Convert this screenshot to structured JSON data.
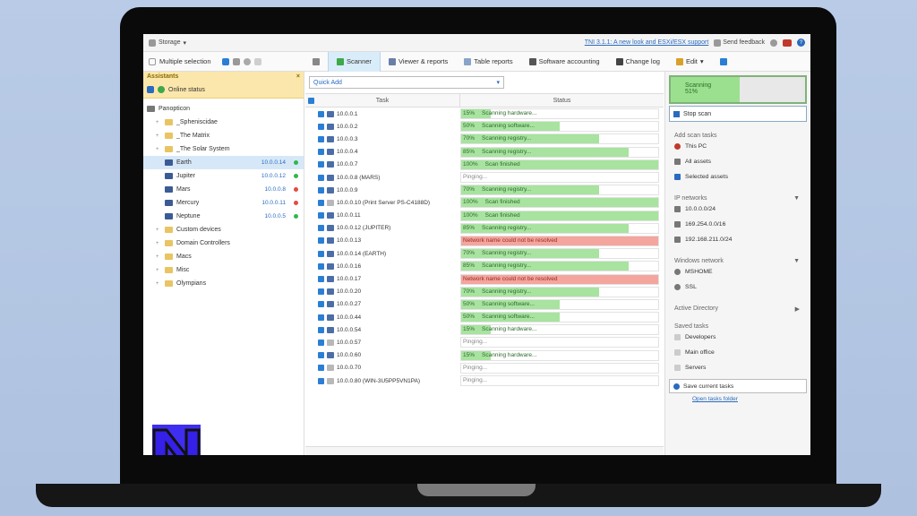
{
  "topbar": {
    "storage_label": "Storage",
    "news_link": "TNI 3.1.1: A new look and ESXi/ESX support",
    "feedback_label": "Send feedback"
  },
  "toolbar": {
    "multiple_selection": "Multiple selection",
    "tabs": [
      "Scanner",
      "Viewer & reports",
      "Table reports",
      "Software accounting",
      "Change log",
      "Edit"
    ]
  },
  "left": {
    "assistants_label": "Assistants",
    "online_status": "Online status",
    "root": "Panopticon",
    "tree": [
      {
        "label": "_Spheniscidae"
      },
      {
        "label": "_The Matrix"
      },
      {
        "label": "_The Solar System"
      },
      {
        "label": "Earth",
        "ip": "10.0.0.14",
        "status": "#2fb84a"
      },
      {
        "label": "Jupiter",
        "ip": "10.0.0.12",
        "status": "#2fb84a"
      },
      {
        "label": "Mars",
        "ip": "10.0.0.8",
        "status": "#e44b3c"
      },
      {
        "label": "Mercury",
        "ip": "10.0.0.11",
        "status": "#e44b3c"
      },
      {
        "label": "Neptune",
        "ip": "10.0.0.5",
        "status": "#2fb84a"
      },
      {
        "label": "Custom devices"
      },
      {
        "label": "Domain Controllers"
      },
      {
        "label": "Macs"
      },
      {
        "label": "Misc"
      },
      {
        "label": "Olympians"
      }
    ]
  },
  "center": {
    "quick_add": "Quick Add",
    "col_task": "Task",
    "col_status": "Status",
    "rows": [
      {
        "task": "10.0.0.1",
        "status": "Scanning hardware...",
        "progress": 15,
        "pct": "15%",
        "kind": "ok",
        "icon": "pc"
      },
      {
        "task": "10.0.0.2",
        "status": "Scanning software...",
        "progress": 50,
        "pct": "50%",
        "kind": "ok",
        "icon": "pc"
      },
      {
        "task": "10.0.0.3",
        "status": "Scanning registry...",
        "progress": 70,
        "pct": "70%",
        "kind": "ok",
        "icon": "pc"
      },
      {
        "task": "10.0.0.4",
        "status": "Scanning registry...",
        "progress": 85,
        "pct": "85%",
        "kind": "ok",
        "icon": "pc"
      },
      {
        "task": "10.0.0.7",
        "status": "Scan finished",
        "progress": 100,
        "pct": "100%",
        "kind": "ok",
        "icon": "pc"
      },
      {
        "task": "10.0.0.8 (MARS)",
        "status": "Pinging...",
        "progress": 0,
        "pct": "",
        "kind": "plain",
        "icon": "pc"
      },
      {
        "task": "10.0.0.9",
        "status": "Scanning registry...",
        "progress": 70,
        "pct": "70%",
        "kind": "ok",
        "icon": "pc"
      },
      {
        "task": "10.0.0.10 (Print Server PS-C4188D)",
        "status": "Scan finished",
        "progress": 100,
        "pct": "100%",
        "kind": "ok",
        "icon": "gray"
      },
      {
        "task": "10.0.0.11",
        "status": "Scan finished",
        "progress": 100,
        "pct": "100%",
        "kind": "ok",
        "icon": "pc"
      },
      {
        "task": "10.0.0.12 (JUPITER)",
        "status": "Scanning registry...",
        "progress": 85,
        "pct": "85%",
        "kind": "ok",
        "icon": "pc"
      },
      {
        "task": "10.0.0.13",
        "status": "Network name could not be resolved",
        "progress": 100,
        "pct": "",
        "kind": "err",
        "icon": "pc"
      },
      {
        "task": "10.0.0.14 (EARTH)",
        "status": "Scanning registry...",
        "progress": 70,
        "pct": "70%",
        "kind": "ok",
        "icon": "pc"
      },
      {
        "task": "10.0.0.16",
        "status": "Scanning registry...",
        "progress": 85,
        "pct": "85%",
        "kind": "ok",
        "icon": "pc"
      },
      {
        "task": "10.0.0.17",
        "status": "Network name could not be resolved",
        "progress": 100,
        "pct": "",
        "kind": "err",
        "icon": "pc"
      },
      {
        "task": "10.0.0.20",
        "status": "Scanning registry...",
        "progress": 70,
        "pct": "70%",
        "kind": "ok",
        "icon": "pc"
      },
      {
        "task": "10.0.0.27",
        "status": "Scanning software...",
        "progress": 50,
        "pct": "50%",
        "kind": "ok",
        "icon": "pc"
      },
      {
        "task": "10.0.0.44",
        "status": "Scanning software...",
        "progress": 50,
        "pct": "50%",
        "kind": "ok",
        "icon": "pc"
      },
      {
        "task": "10.0.0.54",
        "status": "Scanning hardware...",
        "progress": 15,
        "pct": "15%",
        "kind": "ok",
        "icon": "pc"
      },
      {
        "task": "10.0.0.57",
        "status": "Pinging...",
        "progress": 0,
        "pct": "",
        "kind": "plain",
        "icon": "gray"
      },
      {
        "task": "10.0.0.60",
        "status": "Scanning hardware...",
        "progress": 15,
        "pct": "15%",
        "kind": "ok",
        "icon": "pc"
      },
      {
        "task": "10.0.0.70",
        "status": "Pinging...",
        "progress": 0,
        "pct": "",
        "kind": "plain",
        "icon": "gray"
      },
      {
        "task": "10.0.0.80 (WIN-3U5PP5VN1PA)",
        "status": "Pinging...",
        "progress": 0,
        "pct": "",
        "kind": "plain",
        "icon": "gray"
      }
    ]
  },
  "right": {
    "scanning_label": "Scanning",
    "scanning_pct": "51%",
    "scanning_progress": 51,
    "stop_scan": "Stop scan",
    "add_scan_tasks": "Add scan tasks",
    "scan_items": [
      "This PC",
      "All assets",
      "Selected assets"
    ],
    "ip_networks": "IP networks",
    "networks": [
      "10.0.0.0/24",
      "169.254.0.0/16",
      "192.168.211.0/24"
    ],
    "windows_network": "Windows network",
    "win_items": [
      "MSHOME",
      "SSL"
    ],
    "active_directory": "Active Directory",
    "saved_tasks": "Saved tasks",
    "saved_items": [
      "Developers",
      "Main office",
      "Servers"
    ],
    "save_current": "Save current tasks",
    "open_folder": "Open tasks folder"
  }
}
